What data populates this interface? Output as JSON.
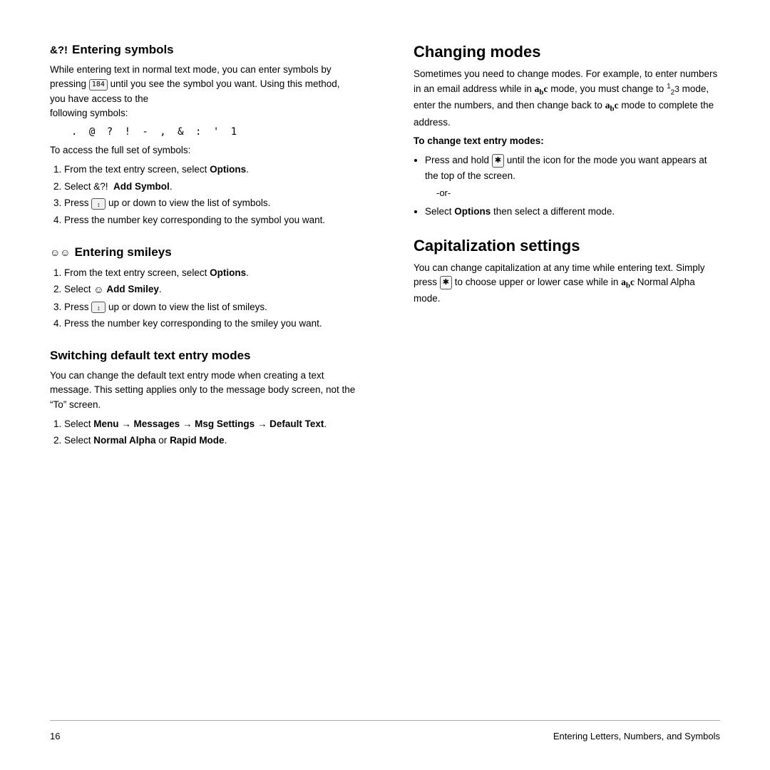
{
  "page": {
    "footer": {
      "page_number": "16",
      "right_text": "Entering Letters, Numbers, and Symbols"
    }
  },
  "left_column": {
    "section1": {
      "icon": "&?!",
      "title": "Entering symbols",
      "intro": "While entering text in normal text mode, you can enter symbols by pressing",
      "intro2": "until you see the symbol you want. Using this method, you have access to the",
      "intro3": "following symbols:",
      "symbols_line": ".  @  ?  !  -  ,  &  :  '  1",
      "full_set_label": "To access the full set of symbols:",
      "steps": [
        "From the text entry screen, select Options.",
        "Select &?!  Add Symbol.",
        "Press  up or down to view the list of symbols.",
        "Press the number key corresponding to the symbol you want."
      ]
    },
    "section2": {
      "icon": "☺",
      "title": "Entering smileys",
      "steps": [
        "From the text entry screen, select Options.",
        "Select  Add Smiley.",
        "Press  up or down to view the list of smileys.",
        "Press the number key corresponding to the smiley you want."
      ]
    },
    "section3": {
      "title": "Switching default text entry modes",
      "intro": "You can change the default text entry mode when creating a text message. This setting applies only to the message body screen, not the “To” screen.",
      "steps": [
        "Select Menu → Messages → Msg Settings → Default Text.",
        "Select Normal Alpha or Rapid Mode."
      ]
    }
  },
  "right_column": {
    "section1": {
      "title": "Changing modes",
      "intro": "Sometimes you need to change modes. For example, to enter numbers in an email address while in",
      "mode_abc": "abc",
      "intro2": "mode, you must change to",
      "mode_123": "123",
      "intro3": "mode, enter the numbers, and then change back to",
      "mode_abc2": "abc",
      "intro4": "mode to complete the address.",
      "change_label": "To change text entry modes:",
      "bullets": [
        "Press and hold  until the icon for the mode you want appears at the top of the screen.",
        "Select Options then select a different mode."
      ],
      "or_text": "-or-"
    },
    "section2": {
      "title": "Capitalization settings",
      "intro": "You can change capitalization at any time while entering text. Simply press",
      "intro2": "to choose upper or lower case while in",
      "mode_abc": "abc",
      "intro3": "Normal Alpha mode."
    }
  }
}
